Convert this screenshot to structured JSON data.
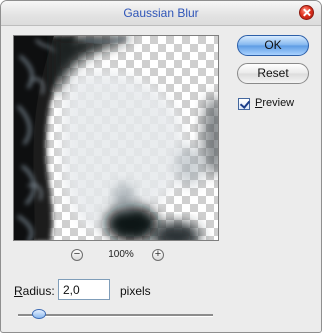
{
  "window": {
    "title": "Gaussian Blur"
  },
  "buttons": {
    "ok_label": "OK",
    "reset_label": "Reset"
  },
  "preview_option": {
    "label": "Preview",
    "checked": true
  },
  "zoom": {
    "zoom_out_symbol": "−",
    "zoom_in_symbol": "+",
    "value": "100%"
  },
  "radius": {
    "label": "Radius:",
    "value": "2,0",
    "unit": "pixels",
    "slider_level_fraction": 0.09
  },
  "colors": {
    "ok_button": "#7fb4ee",
    "title_text": "#2f55b8",
    "close_button": "#e0321f"
  },
  "icons": [
    "close-icon",
    "zoom-out-icon",
    "zoom-in-icon",
    "checkmark-icon"
  ]
}
